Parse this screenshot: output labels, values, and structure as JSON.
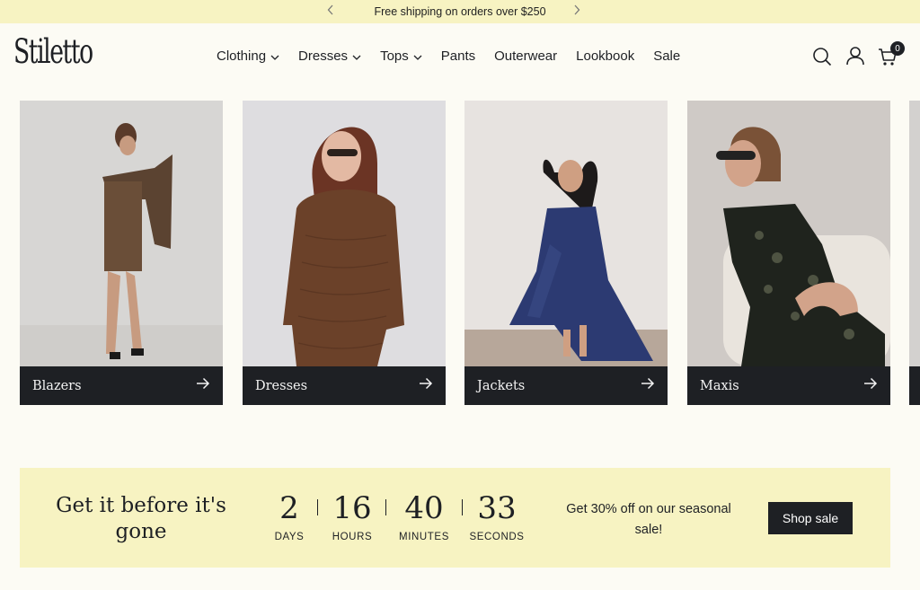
{
  "announcement": {
    "text": "Free shipping on orders over $250",
    "prev_icon": "chevron-left-icon",
    "next_icon": "chevron-right-icon"
  },
  "header": {
    "logo": "Stiletto",
    "nav": [
      {
        "label": "Clothing",
        "has_dropdown": true
      },
      {
        "label": "Dresses",
        "has_dropdown": true
      },
      {
        "label": "Tops",
        "has_dropdown": true
      },
      {
        "label": "Pants",
        "has_dropdown": false
      },
      {
        "label": "Outerwear",
        "has_dropdown": false
      },
      {
        "label": "Lookbook",
        "has_dropdown": false
      },
      {
        "label": "Sale",
        "has_dropdown": false
      }
    ],
    "icons": [
      "search-icon",
      "account-icon",
      "cart-icon"
    ],
    "cart_count": "0"
  },
  "categories": [
    {
      "label": "Blazers"
    },
    {
      "label": "Dresses"
    },
    {
      "label": "Jackets"
    },
    {
      "label": "Maxis"
    }
  ],
  "promo": {
    "headline": "Get it before it's gone",
    "countdown": [
      {
        "value": "2",
        "label": "DAYS"
      },
      {
        "value": "16",
        "label": "HOURS"
      },
      {
        "value": "40",
        "label": "MINUTES"
      },
      {
        "value": "33",
        "label": "SECONDS"
      }
    ],
    "offer": "Get 30% off on our seasonal sale!",
    "button": "Shop sale"
  },
  "colors": {
    "background": "#fcfbf4",
    "announcement_bg": "#f7f3c2",
    "dark": "#1e2024"
  }
}
